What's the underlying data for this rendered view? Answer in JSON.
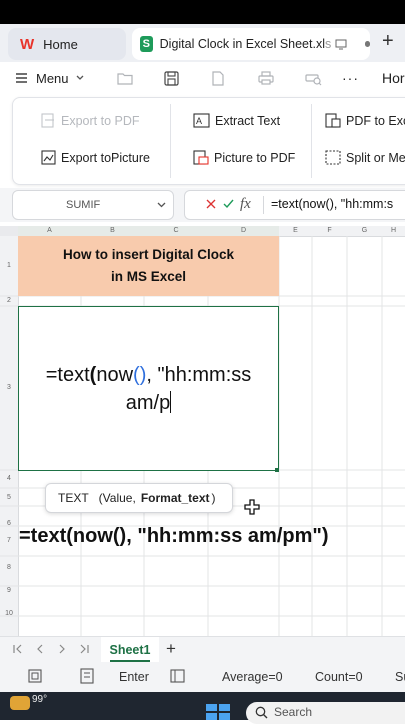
{
  "tabs": {
    "home_label": "Home",
    "doc_icon_letter": "S",
    "doc_label": "Digital Clock in Excel Sheet.xl",
    "doc_ext_fragment": "s"
  },
  "toolbar": {
    "menu_label": "Menu",
    "more_label": "···",
    "home_fragment": "Hor"
  },
  "ribbon": {
    "export_pdf": "Export to PDF",
    "extract_text": "Extract Text",
    "pdf_to_excel": "PDF to Exce",
    "export_picture": "Export toPicture",
    "picture_to_pdf": "Picture to PDF",
    "split_or_merge": "Split or Mer"
  },
  "formula_bar": {
    "name_box": "SUMIF",
    "fx": "fx",
    "formula_text": "=text(now(), \"hh:mm:s"
  },
  "grid": {
    "columns": [
      "A",
      "B",
      "C",
      "D",
      "E",
      "F",
      "G",
      "H"
    ],
    "rows": [
      "1",
      "2",
      "3",
      "4",
      "5",
      "6",
      "7",
      "8",
      "9",
      "10"
    ],
    "title_line1": "How to insert Digital Clock",
    "title_line2": "in MS Excel",
    "edit_line1_a": "=text",
    "edit_line1_paren": "(",
    "edit_line1_b": "now",
    "edit_line1_c": "()",
    "edit_line1_d": ", \"hh:mm:ss",
    "edit_line2": "am/p",
    "tooltip_fn": "TEXT",
    "tooltip_args": "(Value,",
    "tooltip_bold": "Format_text",
    "tooltip_close": ")",
    "row7_text": "=text(now(), \"hh:mm:ss am/pm\")"
  },
  "colors": {
    "title_fill": "#f8cbad",
    "accent_green": "#1e7145",
    "wps_red": "#e8332a",
    "paren_blue": "#2f6fdd"
  },
  "sheet_tabs": {
    "active": "Sheet1",
    "add": "+"
  },
  "status_bar": {
    "enter": "Enter",
    "average": "Average=0",
    "count": "Count=0",
    "sum_fragment": "Su"
  },
  "taskbar": {
    "temperature": "99°",
    "search": "Search"
  }
}
